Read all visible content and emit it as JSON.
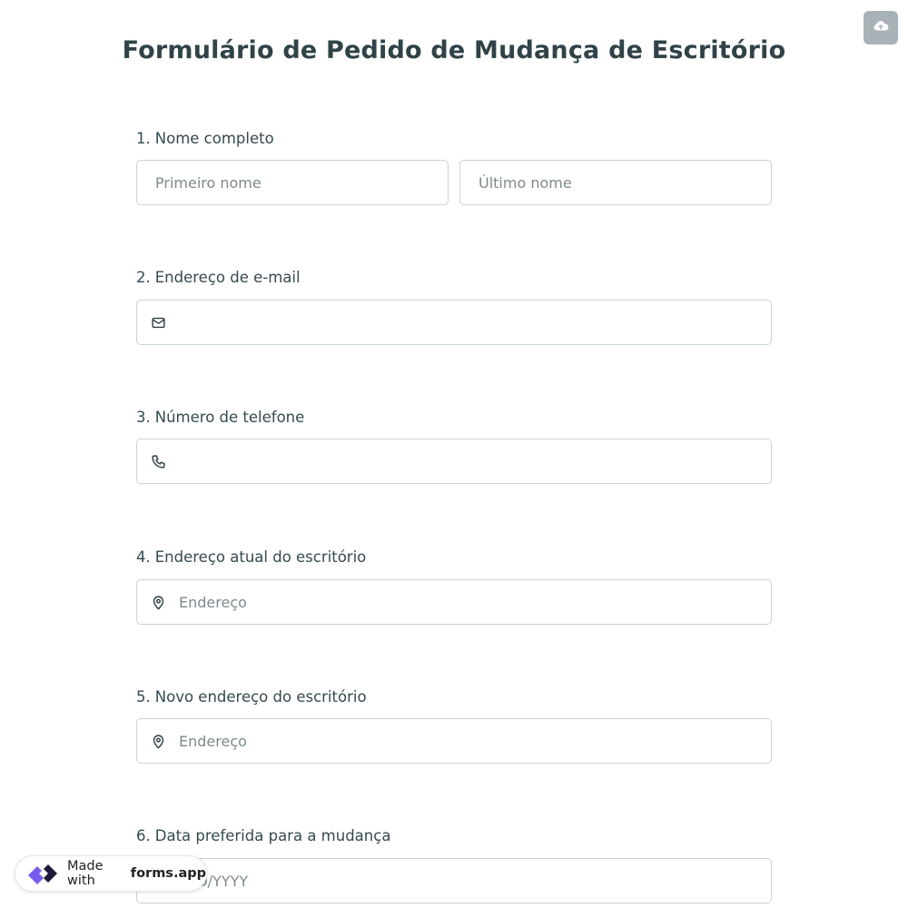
{
  "header": {
    "title": "Formulário de Pedido de Mudança de Escritório"
  },
  "questions": [
    {
      "number": "1.",
      "label": "Nome completo",
      "first_placeholder": "Primeiro nome",
      "last_placeholder": "Último nome"
    },
    {
      "number": "2.",
      "label": "Endereço de e-mail",
      "placeholder": ""
    },
    {
      "number": "3.",
      "label": "Número de telefone",
      "placeholder": ""
    },
    {
      "number": "4.",
      "label": "Endereço atual do escritório",
      "placeholder": "Endereço"
    },
    {
      "number": "5.",
      "label": "Novo endereço do escritório",
      "placeholder": "Endereço"
    },
    {
      "number": "6.",
      "label": "Data preferida para a mudança",
      "placeholder": "MM/DD/YYYY"
    }
  ],
  "badge": {
    "prefix": "Made with",
    "brand": "forms.app"
  },
  "icons": {
    "save": "cloud-upload-icon",
    "email": "envelope-icon",
    "phone": "phone-icon",
    "location": "map-pin-icon",
    "brand": "forms-app-logo"
  },
  "colors": {
    "title": "#2f4348",
    "border": "#ccd3d7",
    "save_button": "#a9b2b6",
    "brand_purple": "#7b5cf0"
  }
}
